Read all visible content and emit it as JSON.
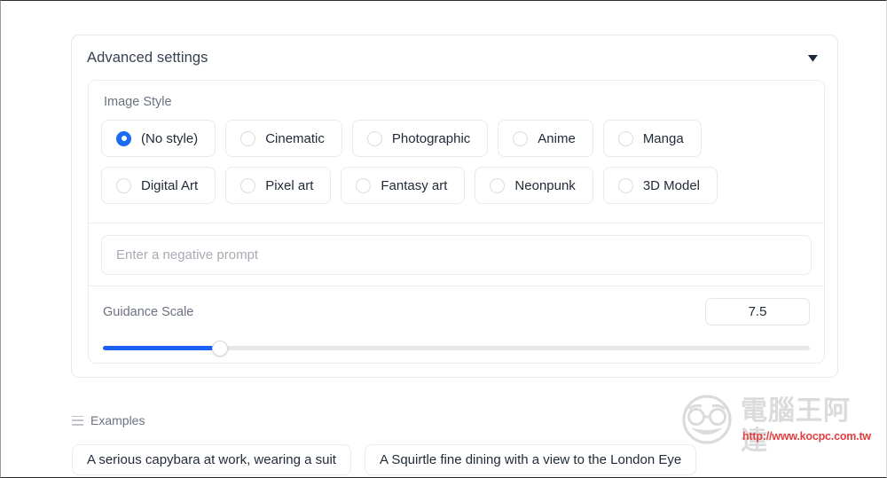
{
  "panel": {
    "title": "Advanced settings",
    "caret_icon": "chevron-down-icon",
    "caret_glyph": "▼"
  },
  "image_style": {
    "label": "Image Style",
    "selected": "(No style)",
    "rows": [
      [
        {
          "label": "(No style)",
          "checked": true
        },
        {
          "label": "Cinematic",
          "checked": false
        },
        {
          "label": "Photographic",
          "checked": false
        },
        {
          "label": "Anime",
          "checked": false
        },
        {
          "label": "Manga",
          "checked": false
        }
      ],
      [
        {
          "label": "Digital Art",
          "checked": false
        },
        {
          "label": "Pixel art",
          "checked": false
        },
        {
          "label": "Fantasy art",
          "checked": false
        },
        {
          "label": "Neonpunk",
          "checked": false
        },
        {
          "label": "3D Model",
          "checked": false
        }
      ]
    ]
  },
  "negative_prompt": {
    "placeholder": "Enter a negative prompt",
    "value": ""
  },
  "guidance_scale": {
    "label": "Guidance Scale",
    "value": "7.5",
    "fill_percent": 16.5
  },
  "examples": {
    "label": "Examples",
    "icon": "list-icon",
    "items": [
      "A serious capybara at work, wearing a suit",
      "A Squirtle fine dining with a view to the London Eye"
    ]
  },
  "watermark": {
    "brand": "電腦王阿達",
    "url": "http://www.kocpc.com.tw"
  },
  "colors": {
    "accent": "#1b6cf2",
    "slider_fill": "#1c5ff5",
    "text": "#1f2937",
    "muted": "#6b7280",
    "border": "#ececee",
    "watermark_red": "#e03030"
  }
}
